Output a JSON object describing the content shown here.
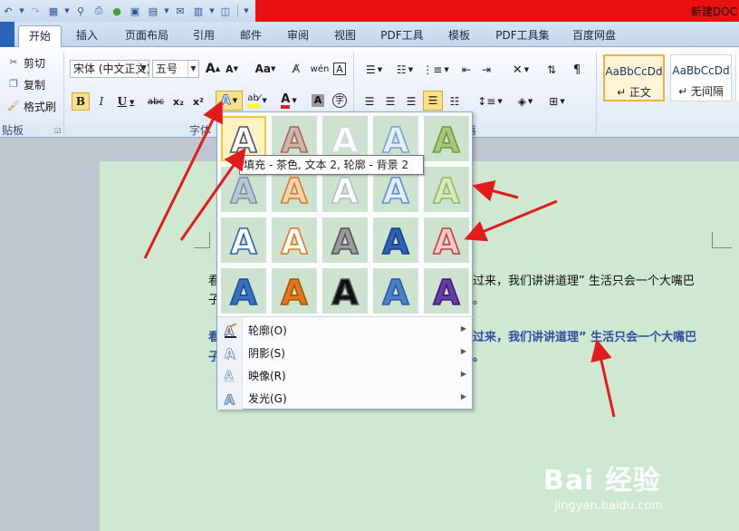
{
  "window": {
    "title": "新建DOC"
  },
  "tabs": [
    "开始",
    "插入",
    "页面布局",
    "引用",
    "邮件",
    "审阅",
    "视图",
    "PDF工具",
    "模板",
    "PDF工具集",
    "百度网盘"
  ],
  "clipboard": {
    "cut": "剪切",
    "copy": "复制",
    "format_painter": "格式刷",
    "group_label": "贴板"
  },
  "font": {
    "name": "宋体 (中文正文)",
    "size": "五号",
    "group_label": "字体",
    "grow": "A",
    "shrink": "A",
    "case": "Aa",
    "bold": "B",
    "italic": "I",
    "underline": "U",
    "strike": "abc",
    "subscript": "x₂",
    "superscript": "x²",
    "text_effect": "A",
    "highlight": "ab⁄",
    "font_color": "A",
    "char_shading": "A",
    "enclose": "字"
  },
  "paragraph": {
    "group_label": "落"
  },
  "styles": [
    {
      "sample": "AaBbCcDd",
      "label": "↵ 正文"
    },
    {
      "sample": "AaBbCcDd",
      "label": "↵ 无间隔"
    }
  ],
  "document": {
    "line1_left": "看",
    "line1_right": "过来，我们讲讲道理” 生活只会一个大嘴巴",
    "line2_left": "子",
    "line2_right": "。",
    "line3_left": "看",
    "line3_right": "过来，我们讲讲道理” 生活只会一个大嘴巴",
    "line4_left": "子",
    "line4_right": "。"
  },
  "text_effects_menu": {
    "tooltip": "填充 - 茶色, 文本 2, 轮廓 - 背景 2",
    "items": [
      {
        "label": "轮廓(O)"
      },
      {
        "label": "阴影(S)"
      },
      {
        "label": "映像(R)"
      },
      {
        "label": "发光(G)"
      }
    ]
  },
  "gallery": [
    [
      {
        "fill": "#ffffff",
        "stroke": "#4a5568"
      },
      {
        "fill": "#c9b8b0",
        "stroke": "#b0605a"
      },
      {
        "fill": "#ffffff",
        "stroke": "#cfd8e0"
      },
      {
        "fill": "#e6f0fb",
        "stroke": "#7aa0cf"
      },
      {
        "fill": "#a6c87a",
        "stroke": "#6f9a3f"
      }
    ],
    [
      {
        "fill": "#b8c8d4",
        "stroke": "#7f93a6"
      },
      {
        "fill": "#f4d4b0",
        "stroke": "#d87a2a"
      },
      {
        "fill": "#ffffff",
        "stroke": "#b5bcc4"
      },
      {
        "fill": "#e4eefa",
        "stroke": "#5b8fd0"
      },
      {
        "fill": "#d8e8c0",
        "stroke": "#94b860"
      }
    ],
    [
      {
        "fill": "#ffffff",
        "stroke": "#2f5fa8"
      },
      {
        "fill": "#ffffff",
        "stroke": "#e07a20"
      },
      {
        "fill": "#9a9a9a",
        "stroke": "#555555"
      },
      {
        "fill": "#2a63b8",
        "stroke": "#1a3f80"
      },
      {
        "fill": "#f4c8c8",
        "stroke": "#c04040"
      }
    ],
    [
      {
        "fill": "#3a72c0",
        "stroke": "#1d4d90"
      },
      {
        "fill": "#e07a18",
        "stroke": "#a85408"
      },
      {
        "fill": "#111111",
        "stroke": "#555555"
      },
      {
        "fill": "#4a80c8",
        "stroke": "#2a5aa0"
      },
      {
        "fill": "#6a3aa8",
        "stroke": "#3d1d70"
      }
    ]
  ],
  "watermark": {
    "brand": "Bai 经验",
    "url": "jingyan.baidu.com"
  }
}
